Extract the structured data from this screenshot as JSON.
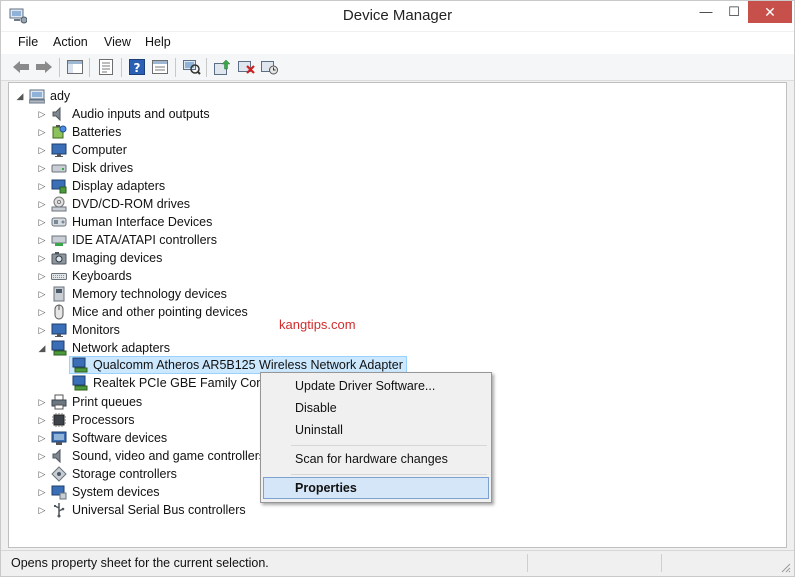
{
  "window": {
    "title": "Device Manager",
    "minimize": "—",
    "maximize": "☐",
    "close": "✕"
  },
  "menu": [
    "File",
    "Action",
    "View",
    "Help"
  ],
  "toolbar": [
    "back-icon",
    "forward-icon",
    "show-hide-tree-icon",
    "properties-sheet-icon",
    "help-icon",
    "update-view-icon",
    "scan-hardware-icon",
    "update-driver-icon",
    "uninstall-icon",
    "enable-device-icon"
  ],
  "tree": {
    "root": "ady",
    "categories": [
      "Audio inputs and outputs",
      "Batteries",
      "Computer",
      "Disk drives",
      "Display adapters",
      "DVD/CD-ROM drives",
      "Human Interface Devices",
      "IDE ATA/ATAPI controllers",
      "Imaging devices",
      "Keyboards",
      "Memory technology devices",
      "Mice and other pointing devices",
      "Monitors",
      "Network adapters"
    ],
    "network_children": [
      "Qualcomm Atheros AR5B125 Wireless Network Adapter",
      "Realtek PCIe GBE Family Controller"
    ],
    "categories_after": [
      "Print queues",
      "Processors",
      "Software devices",
      "Sound, video and game controllers",
      "Storage controllers",
      "System devices",
      "Universal Serial Bus controllers"
    ]
  },
  "watermark": "kangtips.com",
  "context_menu": {
    "update": "Update Driver Software...",
    "disable": "Disable",
    "uninstall": "Uninstall",
    "scan": "Scan for hardware changes",
    "properties": "Properties"
  },
  "status": "Opens property sheet for the current selection.",
  "colors": {
    "selection": "#cce8ff",
    "close": "#c7514a",
    "watermark": "#d22c2c"
  }
}
